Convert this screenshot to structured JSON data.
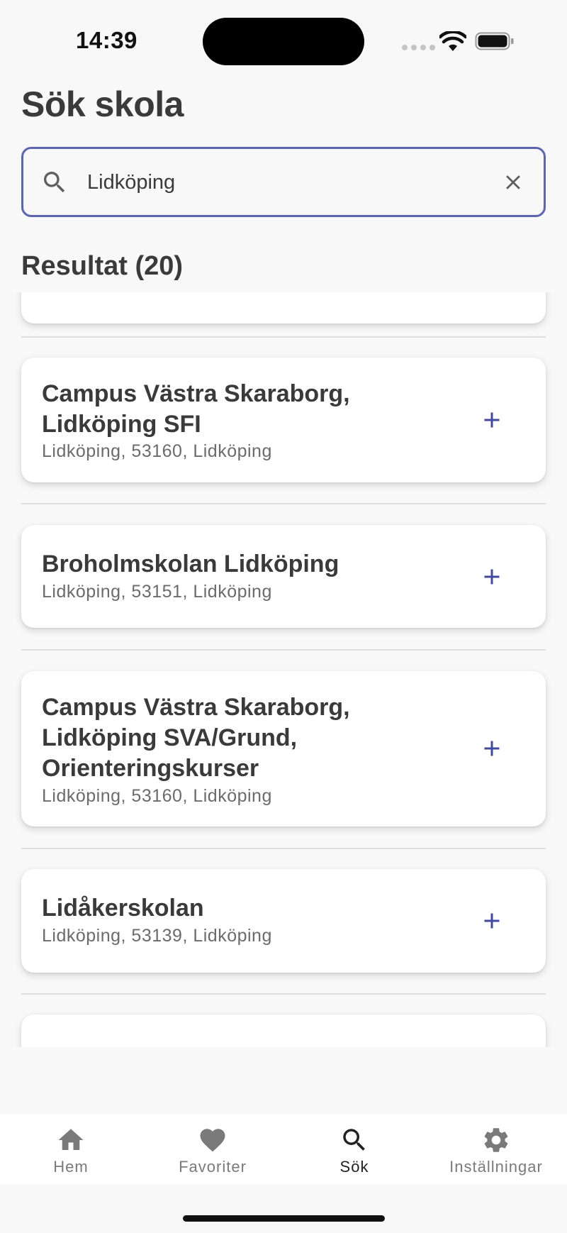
{
  "status_bar": {
    "time": "14:39"
  },
  "title": "Sök skola",
  "search": {
    "value": "Lidköping",
    "placeholder": ""
  },
  "results_header": "Resultat (20)",
  "results": [
    {
      "name": "Campus Västra Skaraborg, Lidköping SFI",
      "subtitle": "Lidköping, 53160, Lidköping"
    },
    {
      "name": "Broholmskolan Lidköping",
      "subtitle": "Lidköping, 53151, Lidköping"
    },
    {
      "name": "Campus Västra Skaraborg, Lidköping SVA/Grund, Orienteringskurser",
      "subtitle": "Lidköping, 53160, Lidköping"
    },
    {
      "name": "Lidåkerskolan",
      "subtitle": "Lidköping, 53139, Lidköping"
    }
  ],
  "nav": [
    {
      "label": "Hem",
      "icon": "home-icon"
    },
    {
      "label": "Favoriter",
      "icon": "heart-icon"
    },
    {
      "label": "Sök",
      "icon": "search-icon",
      "active": true
    },
    {
      "label": "Inställningar",
      "icon": "gear-icon"
    }
  ],
  "colors": {
    "accent": "#3f4aa0",
    "search_border": "#5a66b0",
    "background": "#f8f8f8"
  }
}
